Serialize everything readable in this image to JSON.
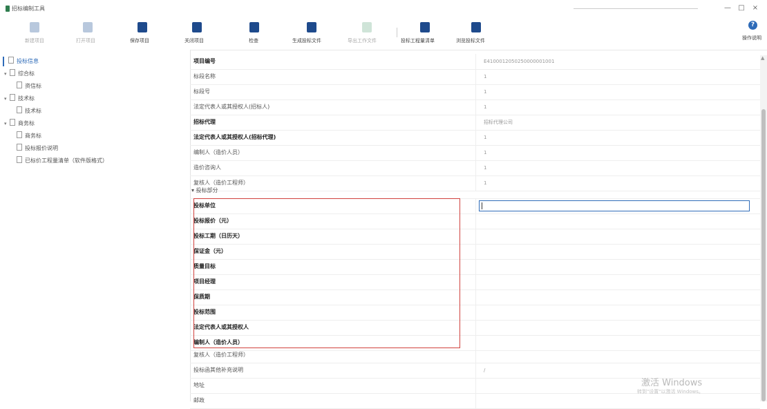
{
  "window": {
    "title": "招标编制工具",
    "min": "—",
    "max": "□",
    "close": "×"
  },
  "toolbar": {
    "buttons": [
      {
        "label": "新建项目",
        "icon": "add-file-icon",
        "disabled": true
      },
      {
        "label": "打开项目",
        "icon": "folder-icon",
        "disabled": true
      },
      {
        "label": "保存项目",
        "icon": "save-icon",
        "disabled": false
      },
      {
        "label": "关闭项目",
        "icon": "close-project-icon",
        "disabled": false
      },
      {
        "label": "检查",
        "icon": "check-icon",
        "disabled": false
      },
      {
        "label": "生成投标文件",
        "icon": "generate-file-icon",
        "disabled": false
      },
      {
        "label": "导出工作文件",
        "icon": "export-icon",
        "disabled": true
      },
      {
        "label": "投标工程量清单",
        "icon": "bill-icon",
        "disabled": false
      },
      {
        "label": "浏览投标文件",
        "icon": "browse-file-icon",
        "disabled": false
      }
    ],
    "help_label": "操作说明",
    "help_icon": "help-icon"
  },
  "sidebar": {
    "items": [
      {
        "label": "投标信息",
        "indent": 0,
        "expandable": false,
        "selected": true
      },
      {
        "label": "综合标",
        "indent": 0,
        "expandable": true
      },
      {
        "label": "资信标",
        "indent": 1,
        "expandable": false
      },
      {
        "label": "技术标",
        "indent": 0,
        "expandable": true
      },
      {
        "label": "技术标",
        "indent": 1,
        "expandable": false
      },
      {
        "label": "商务标",
        "indent": 0,
        "expandable": true
      },
      {
        "label": "商务标",
        "indent": 1,
        "expandable": false
      },
      {
        "label": "投标报价说明",
        "indent": 1,
        "expandable": false
      },
      {
        "label": "已标价工程量清单（软件版格式）",
        "indent": 1,
        "expandable": false
      }
    ]
  },
  "grid": {
    "rows": [
      {
        "label": "项目编号",
        "value": "E4100012050250000001001",
        "bold": true
      },
      {
        "label": "标段名称",
        "value": "1",
        "bold": false
      },
      {
        "label": "标段号",
        "value": "1",
        "bold": false
      },
      {
        "label": "法定代表人或其授权人(招标人)",
        "value": "1",
        "bold": false
      },
      {
        "label": "招标代理",
        "value": "招标代理公司",
        "bold": true
      },
      {
        "label": "法定代表人或其授权人(招标代理)",
        "value": "1",
        "bold": true
      },
      {
        "label": "编制人（造价人员）",
        "value": "1",
        "bold": false
      },
      {
        "label": "造价咨询人",
        "value": "1",
        "bold": false
      },
      {
        "label": "复核人（造价工程师）",
        "value": "1",
        "bold": false
      },
      {
        "label": "▾ 投标部分",
        "value": "",
        "group": true
      },
      {
        "label": "投标单位",
        "value": "",
        "bold": true,
        "active": true
      },
      {
        "label": "投标报价（元）",
        "value": "",
        "bold": true
      },
      {
        "label": "投标工期（日历天）",
        "value": "",
        "bold": true
      },
      {
        "label": "保证金（元）",
        "value": "",
        "bold": true
      },
      {
        "label": "质量目标",
        "value": "",
        "bold": true
      },
      {
        "label": "项目经理",
        "value": "",
        "bold": true
      },
      {
        "label": "保质期",
        "value": "",
        "bold": true
      },
      {
        "label": "投标范围",
        "value": "",
        "bold": true
      },
      {
        "label": "法定代表人或其授权人",
        "value": "",
        "bold": true
      },
      {
        "label": "编制人（造价人员）",
        "value": "",
        "bold": true
      },
      {
        "label": "复核人（造价工程师）",
        "value": "",
        "bold": false
      },
      {
        "label": "投标函其他补充说明",
        "value": "/",
        "bold": false
      },
      {
        "label": "地址",
        "value": "",
        "bold": false
      },
      {
        "label": "邮政",
        "value": "",
        "bold": false
      }
    ]
  },
  "watermark": {
    "line1": "激活 Windows",
    "line2": "转到\"设置\"以激活 Windows。"
  },
  "colors": {
    "accent": "#2e6bb8",
    "highlight_box": "#d0403c",
    "toolbar_icon": "#1e4a8c"
  }
}
